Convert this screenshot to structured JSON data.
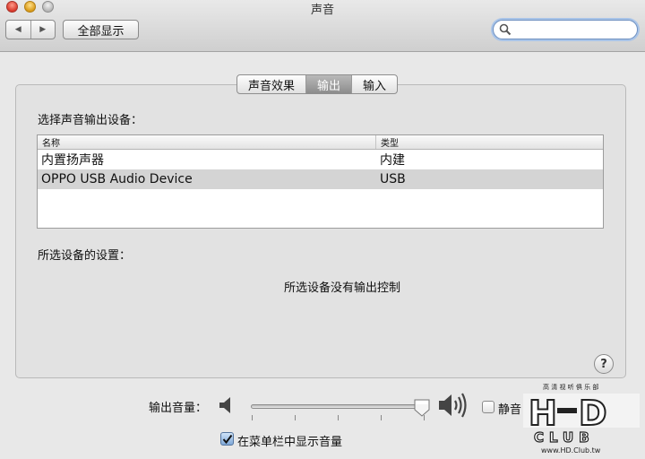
{
  "window": {
    "title": "声音"
  },
  "toolbar": {
    "back_icon": "◀",
    "forward_icon": "▶",
    "show_all_label": "全部显示",
    "search_value": "",
    "search_placeholder": ""
  },
  "tabs": [
    {
      "label": "声音效果",
      "active": false
    },
    {
      "label": "输出",
      "active": true
    },
    {
      "label": "输入",
      "active": false
    }
  ],
  "output": {
    "choose_device_label": "选择声音输出设备：",
    "columns": [
      "名称",
      "类型"
    ],
    "devices": [
      {
        "name": "内置扬声器",
        "type": "内建",
        "selected": false
      },
      {
        "name": "OPPO USB Audio Device",
        "type": "USB",
        "selected": true
      }
    ],
    "settings_label": "所选设备的设置：",
    "no_controls_text": "所选设备没有输出控制"
  },
  "help": {
    "label": "?"
  },
  "volume": {
    "label": "输出音量：",
    "level": 1.0,
    "mute_label": "静音",
    "mute_checked": false,
    "show_in_menu_label": "在菜单栏中显示音量",
    "show_in_menu_checked": true
  },
  "watermark": {
    "top_text": "高 清 视 听 俱 乐 部",
    "logo_text": "HD CLUB",
    "url": "www.HD.Club.tw"
  },
  "colors": {
    "search_focus": "#a9c4e8",
    "tab_active": "#8c8c8c",
    "row_selected": "#d4d4d4",
    "checkbox_blue": "#7fa8d8"
  }
}
